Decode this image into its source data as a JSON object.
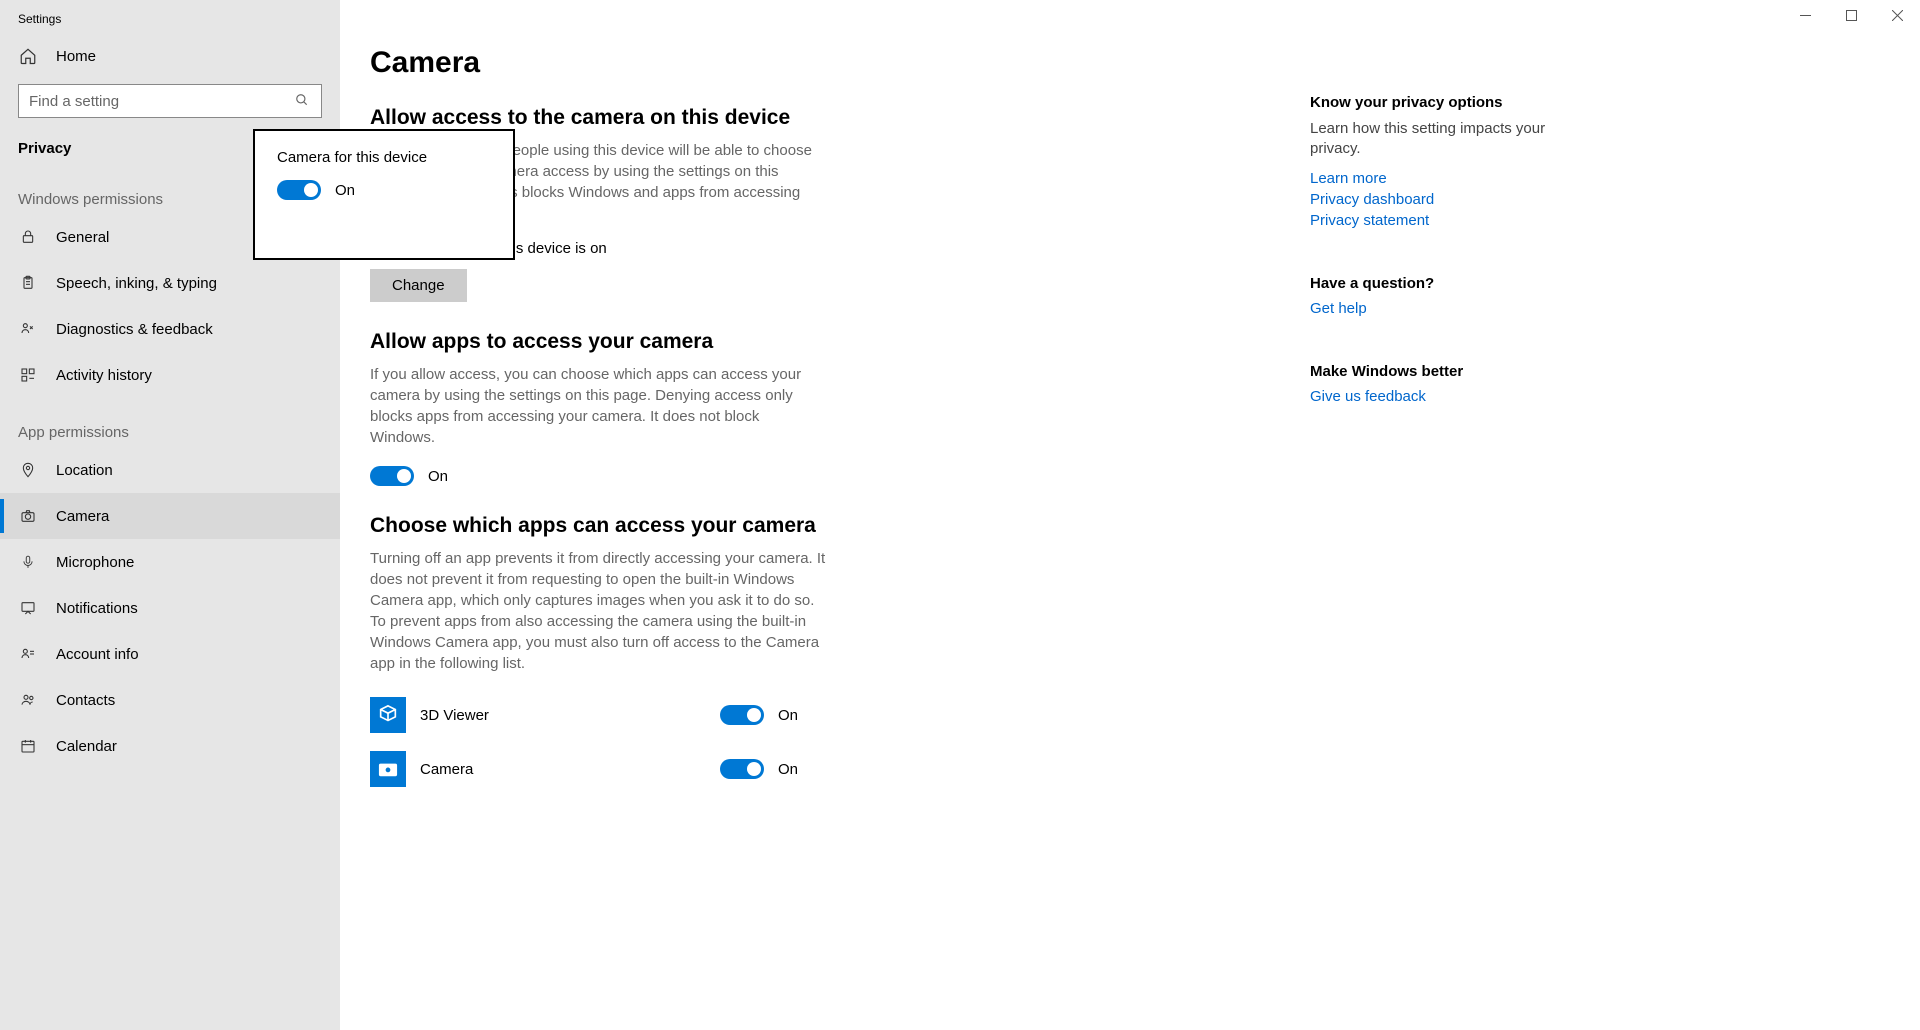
{
  "app_title": "Settings",
  "sidebar": {
    "home": "Home",
    "search_placeholder": "Find a setting",
    "category": "Privacy",
    "group_windows": "Windows permissions",
    "group_apps": "App permissions",
    "items_windows": [
      {
        "label": "General"
      },
      {
        "label": "Speech, inking, & typing"
      },
      {
        "label": "Diagnostics & feedback"
      },
      {
        "label": "Activity history"
      }
    ],
    "items_apps": [
      {
        "label": "Location"
      },
      {
        "label": "Camera"
      },
      {
        "label": "Microphone"
      },
      {
        "label": "Notifications"
      },
      {
        "label": "Account info"
      },
      {
        "label": "Contacts"
      },
      {
        "label": "Calendar"
      }
    ]
  },
  "page": {
    "title": "Camera",
    "section1_title": "Allow access to the camera on this device",
    "section1_desc": "If you allow access, people using this device will be able to choose if their apps have camera access by using the settings on this page. Denying access blocks Windows and apps from accessing the camera.",
    "section1_status": "Camera access for this device is on",
    "change_btn": "Change",
    "section2_title": "Allow apps to access your camera",
    "section2_desc": "If you allow access, you can choose which apps can access your camera by using the settings on this page. Denying access only blocks apps from accessing your camera. It does not block Windows.",
    "toggle_on": "On",
    "section3_title": "Choose which apps can access your camera",
    "section3_desc": "Turning off an app prevents it from directly accessing your camera. It does not prevent it from requesting to open the built-in Windows Camera app, which only captures images when you ask it to do so. To prevent apps from also accessing the camera using the built-in Windows Camera app, you must also turn off access to the Camera app in the following list.",
    "apps": [
      {
        "name": "3D Viewer",
        "state": "On"
      },
      {
        "name": "Camera",
        "state": "On"
      }
    ]
  },
  "popup": {
    "title": "Camera for this device",
    "state": "On"
  },
  "right": {
    "block1_title": "Know your privacy options",
    "block1_desc": "Learn how this setting impacts your privacy.",
    "link_learn": "Learn more",
    "link_dashboard": "Privacy dashboard",
    "link_statement": "Privacy statement",
    "block2_title": "Have a question?",
    "link_help": "Get help",
    "block3_title": "Make Windows better",
    "link_feedback": "Give us feedback"
  }
}
